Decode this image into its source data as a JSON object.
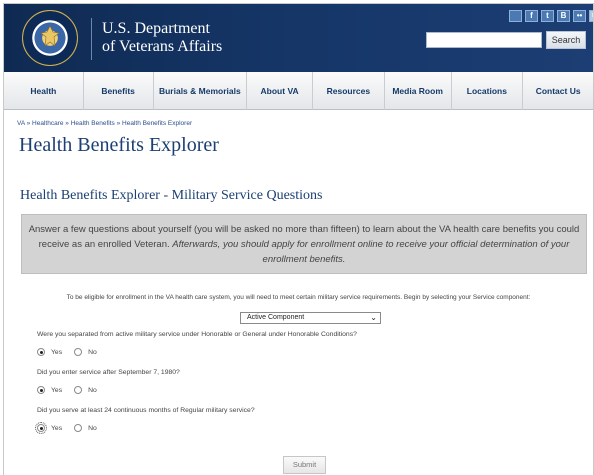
{
  "header": {
    "agency_line1": "U.S. Department",
    "agency_line2": "of Veterans Affairs",
    "social_icons": [
      "share-icon",
      "facebook-icon",
      "twitter-icon",
      "blog-icon",
      "flickr-icon",
      "email-icon"
    ],
    "search": {
      "placeholder": "",
      "button_label": "Search"
    }
  },
  "nav": {
    "items": [
      {
        "label": "Health"
      },
      {
        "label": "Benefits"
      },
      {
        "label": "Burials & Memorials"
      },
      {
        "label": "About VA"
      },
      {
        "label": "Resources"
      },
      {
        "label": "Media Room"
      },
      {
        "label": "Locations"
      },
      {
        "label": "Contact Us"
      }
    ]
  },
  "breadcrumb": "VA » Healthcare » Health Benefits » Health Benefits Explorer",
  "page_title": "Health Benefits Explorer",
  "section_title": "Health Benefits Explorer - Military Service Questions",
  "intro": {
    "text_normal": "Answer a few questions about yourself (you will be asked no more than fifteen) to learn about the VA health care benefits you could receive as an enrolled Veteran. ",
    "text_italic": "Afterwards, you should apply for enrollment online to receive your official determination of your enrollment benefits."
  },
  "eligibility_text": "To be eligible for enrollment in the VA health care system, you will need to meet certain military service requirements. Begin by selecting your Service component:",
  "service_component": {
    "selected": "Active Component"
  },
  "questions": [
    {
      "text": "Were you separated from active military service under Honorable or General under Honorable Conditions?",
      "yes": "Yes",
      "no": "No",
      "answer": "Yes"
    },
    {
      "text": "Did you enter service after September 7, 1980?",
      "yes": "Yes",
      "no": "No",
      "answer": "Yes"
    },
    {
      "text": "Did you serve at least 24 continuous months of Regular military service?",
      "yes": "Yes",
      "no": "No",
      "answer": "Yes"
    }
  ],
  "submit_label": "Submit",
  "colors": {
    "header_bg": "#153566",
    "title_blue": "#1b3f73",
    "intro_bg": "#d3d3d3"
  }
}
